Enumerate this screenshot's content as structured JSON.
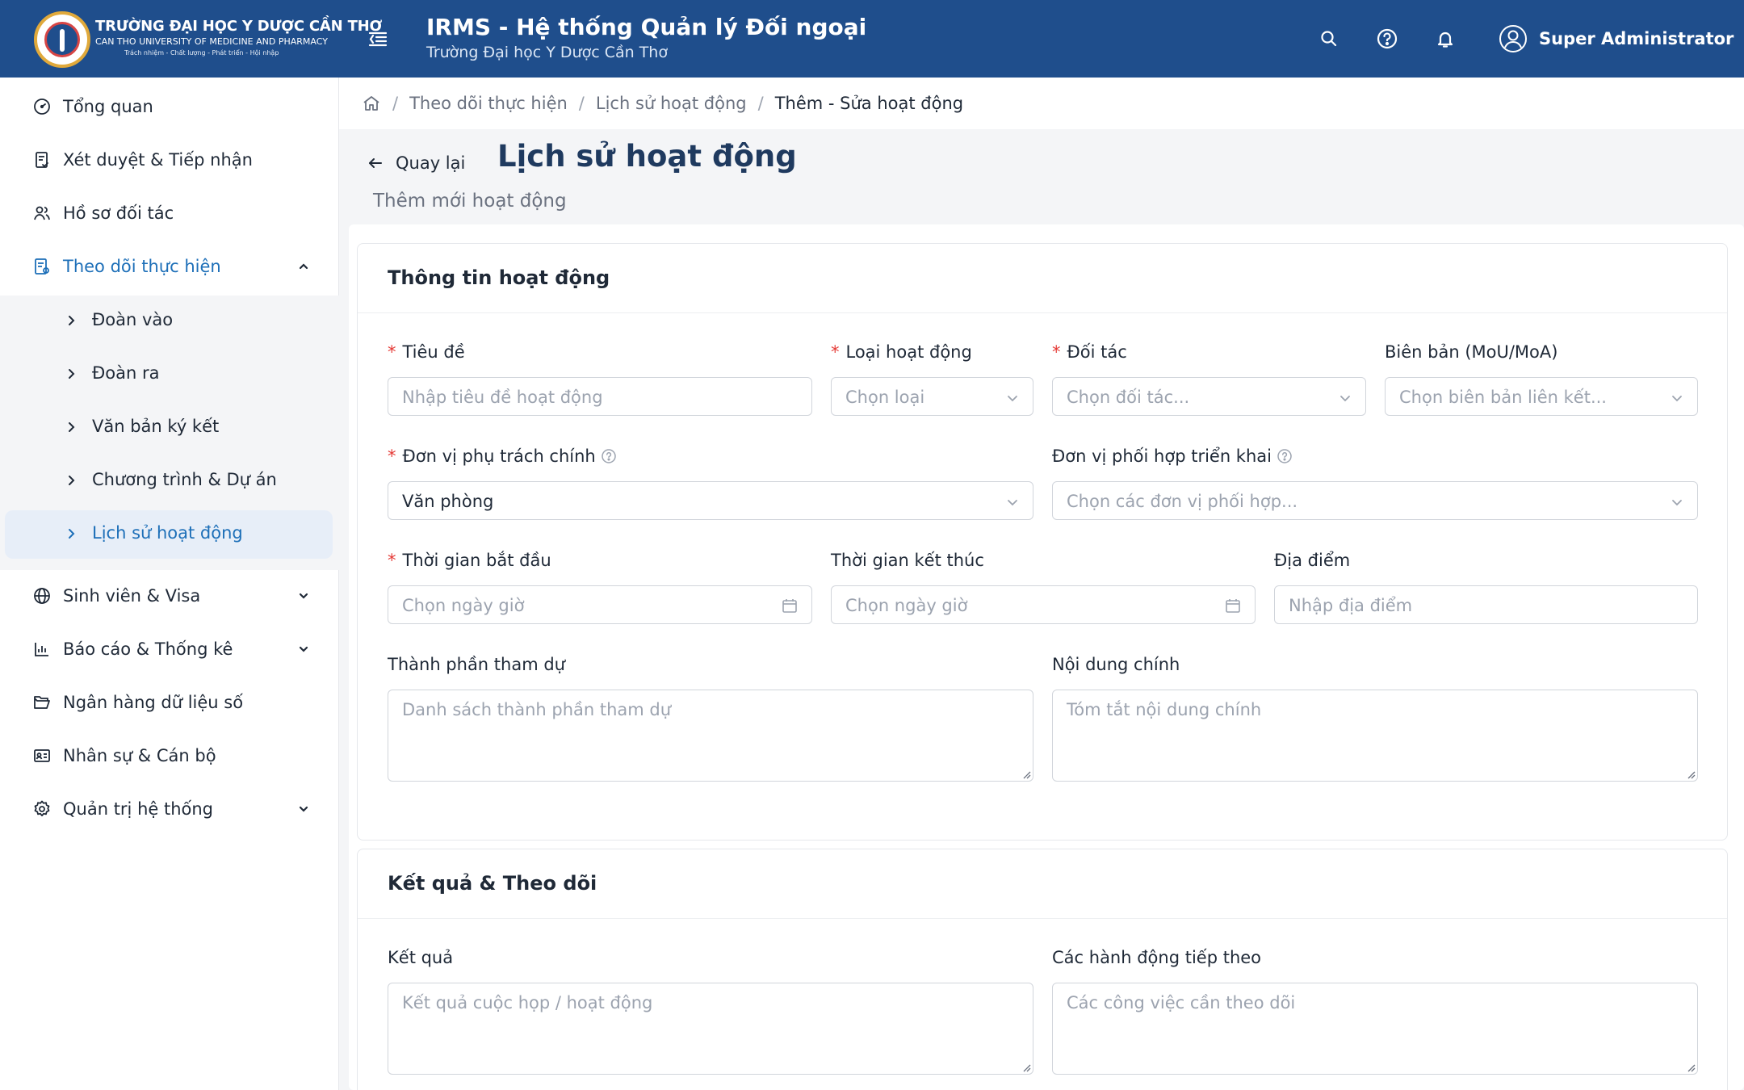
{
  "header": {
    "logo_line1": "TRƯỜNG ĐẠI HỌC Y DƯỢC CẦN THƠ",
    "logo_line2": "CAN THO UNIVERSITY OF MEDICINE AND PHARMACY",
    "logo_line3": "Trách nhiệm - Chất lượng - Phát triển - Hội nhập",
    "app_title": "IRMS - Hệ thống Quản lý Đối ngoại",
    "app_subtitle": "Trường Đại học Y Dược Cần Thơ",
    "user_name": "Super Administrator",
    "brand_color": "#1f4e8c"
  },
  "sidebar": {
    "items": [
      {
        "label": "Tổng quan",
        "icon": "dashboard-icon"
      },
      {
        "label": "Xét duyệt & Tiếp nhận",
        "icon": "clipboard-check-icon"
      },
      {
        "label": "Hồ sơ đối tác",
        "icon": "partners-icon"
      },
      {
        "label": "Theo dõi thực hiện",
        "icon": "tracking-icon",
        "expanded": true
      },
      {
        "label": "Sinh viên & Visa",
        "icon": "globe-icon"
      },
      {
        "label": "Báo cáo & Thống kê",
        "icon": "bar-chart-icon"
      },
      {
        "label": "Ngân hàng dữ liệu số",
        "icon": "folder-open-icon"
      },
      {
        "label": "Nhân sự & Cán bộ",
        "icon": "id-card-icon"
      },
      {
        "label": "Quản trị hệ thống",
        "icon": "gear-icon"
      }
    ],
    "subitems": [
      {
        "label": "Đoàn vào"
      },
      {
        "label": "Đoàn ra"
      },
      {
        "label": "Văn bản ký kết"
      },
      {
        "label": "Chương trình & Dự án"
      },
      {
        "label": "Lịch sử hoạt động",
        "active": true
      }
    ],
    "active_color": "#1d6fb8"
  },
  "breadcrumb": [
    "Theo dõi thực hiện",
    "Lịch sử hoạt động",
    "Thêm - Sửa hoạt động"
  ],
  "page": {
    "back_label": "Quay lại",
    "title": "Lịch sử hoạt động",
    "subtitle": "Thêm mới hoạt động"
  },
  "section1": {
    "title": "Thông tin hoạt động",
    "tieu_de": {
      "label": "Tiêu đề",
      "placeholder": "Nhập tiêu đề hoạt động"
    },
    "loai": {
      "label": "Loại hoạt động",
      "placeholder": "Chọn loại"
    },
    "doi_tac": {
      "label": "Đối tác",
      "placeholder": "Chọn đối tác..."
    },
    "bien_ban": {
      "label": "Biên bản (MoU/MoA)",
      "placeholder": "Chọn biên bản liên kết..."
    },
    "don_vi_chinh": {
      "label": "Đơn vị phụ trách chính",
      "value": "Văn phòng"
    },
    "don_vi_phoi_hop": {
      "label": "Đơn vị phối hợp triển khai",
      "placeholder": "Chọn các đơn vị phối hợp..."
    },
    "bat_dau": {
      "label": "Thời gian bắt đầu",
      "placeholder": "Chọn ngày giờ"
    },
    "ket_thuc": {
      "label": "Thời gian kết thúc",
      "placeholder": "Chọn ngày giờ"
    },
    "dia_diem": {
      "label": "Địa điểm",
      "placeholder": "Nhập địa điểm"
    },
    "thanh_phan": {
      "label": "Thành phần tham dự",
      "placeholder": "Danh sách thành phần tham dự"
    },
    "noi_dung": {
      "label": "Nội dung chính",
      "placeholder": "Tóm tắt nội dung chính"
    }
  },
  "section2": {
    "title": "Kết quả & Theo dõi",
    "ket_qua": {
      "label": "Kết quả",
      "placeholder": "Kết quả cuộc họp / hoạt động"
    },
    "hanh_dong": {
      "label": "Các hành động tiếp theo",
      "placeholder": "Các công việc cần theo dõi"
    }
  },
  "required_marker": "*"
}
